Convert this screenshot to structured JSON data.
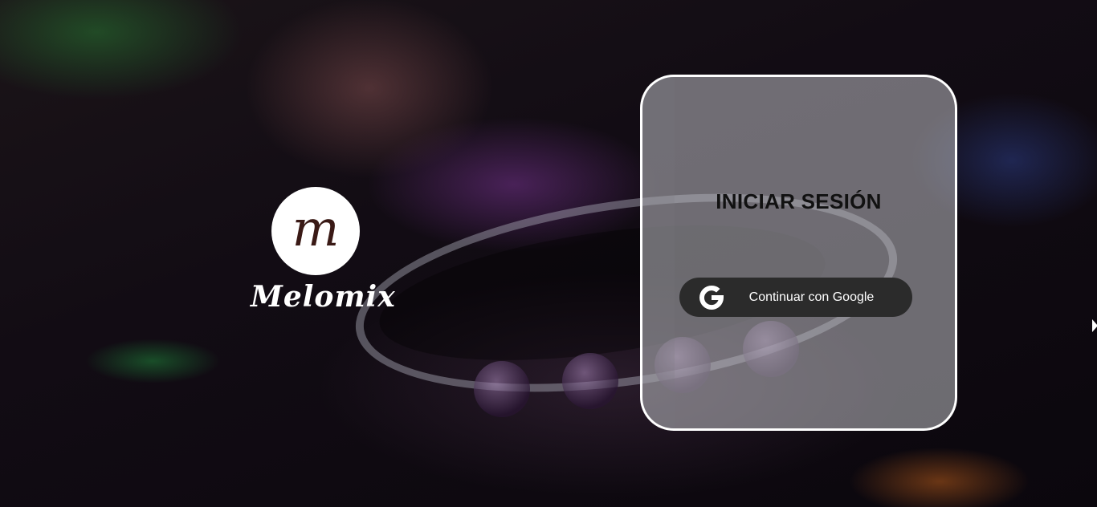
{
  "brand": {
    "logo_letter": "m",
    "name": "Melomix"
  },
  "login": {
    "title": "INICIAR SESIÓN",
    "google_button_label": "Continuar con Google"
  },
  "icons": {
    "google": "google-icon",
    "cursor": "mouse-pointer-icon"
  },
  "colors": {
    "card_border": "#ffffff",
    "button_bg": "#2b2b2b",
    "title_text": "#111111"
  }
}
